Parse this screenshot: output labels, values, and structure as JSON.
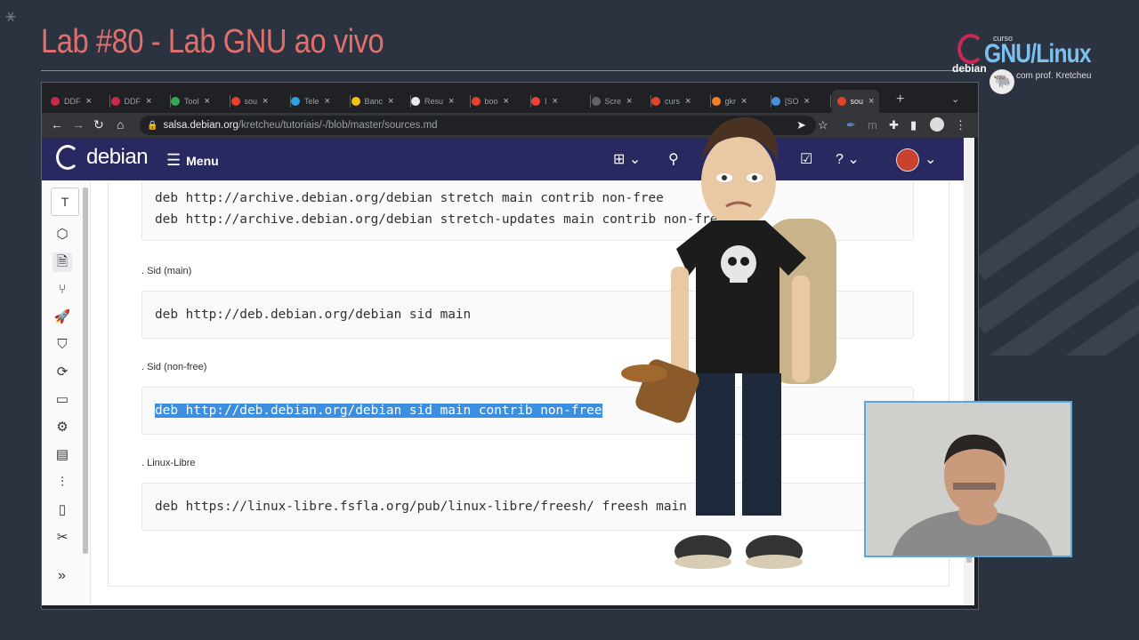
{
  "slide": {
    "title": "Lab #80 - Lab GNU ao vivo",
    "brand": {
      "curso": "curso",
      "name": "GNU/Linux",
      "debian": "debian",
      "prof": "com prof. Kretcheu"
    }
  },
  "browser": {
    "tabs": [
      {
        "label": "DDF",
        "color": "#c8294f"
      },
      {
        "label": "DDF",
        "color": "#c8294f"
      },
      {
        "label": "Tool",
        "color": "#34a853"
      },
      {
        "label": "sou",
        "color": "#e24329"
      },
      {
        "label": "Tele",
        "color": "#2aa3e0"
      },
      {
        "label": "Banc",
        "color": "#f4c20d"
      },
      {
        "label": "Resu",
        "color": "#e8eaed"
      },
      {
        "label": "boo",
        "color": "#e24329"
      },
      {
        "label": "I",
        "color": "#ea4335"
      },
      {
        "label": "Scre",
        "color": "#5f6368"
      },
      {
        "label": "curs",
        "color": "#e24329"
      },
      {
        "label": "gkr",
        "color": "#f48024"
      },
      {
        "label": "[SO",
        "color": "#4a90e2"
      },
      {
        "label": "sou",
        "color": "#e24329",
        "active": true
      }
    ],
    "url_host": "salsa.debian.org",
    "url_path": "/kretcheu/tutoriais/-/blob/master/sources.md"
  },
  "gitlab": {
    "logo": "debian",
    "menu_label": "Menu",
    "sidebar_initial": "T"
  },
  "document": {
    "block1": [
      "deb http://archive.debian.org/debian stretch main contrib non-free",
      "deb http://archive.debian.org/debian stretch-updates main contrib non-free"
    ],
    "heading_sid_main": ". Sid (main)",
    "block_sid_main": "deb http://deb.debian.org/debian sid main",
    "heading_sid_nonfree": ". Sid (non-free)",
    "block_sid_nonfree": "deb http://deb.debian.org/debian sid main contrib non-free",
    "heading_linux_libre": ". Linux-Libre",
    "block_linux_libre": "deb https://linux-libre.fsfla.org/pub/linux-libre/freesh/ freesh main"
  },
  "colors": {
    "slide_bg": "#2c3340",
    "title": "#e0706c",
    "gitlab_nav": "#292961",
    "selection": "#3c8fe0",
    "webcam_border": "#58a8e0"
  }
}
